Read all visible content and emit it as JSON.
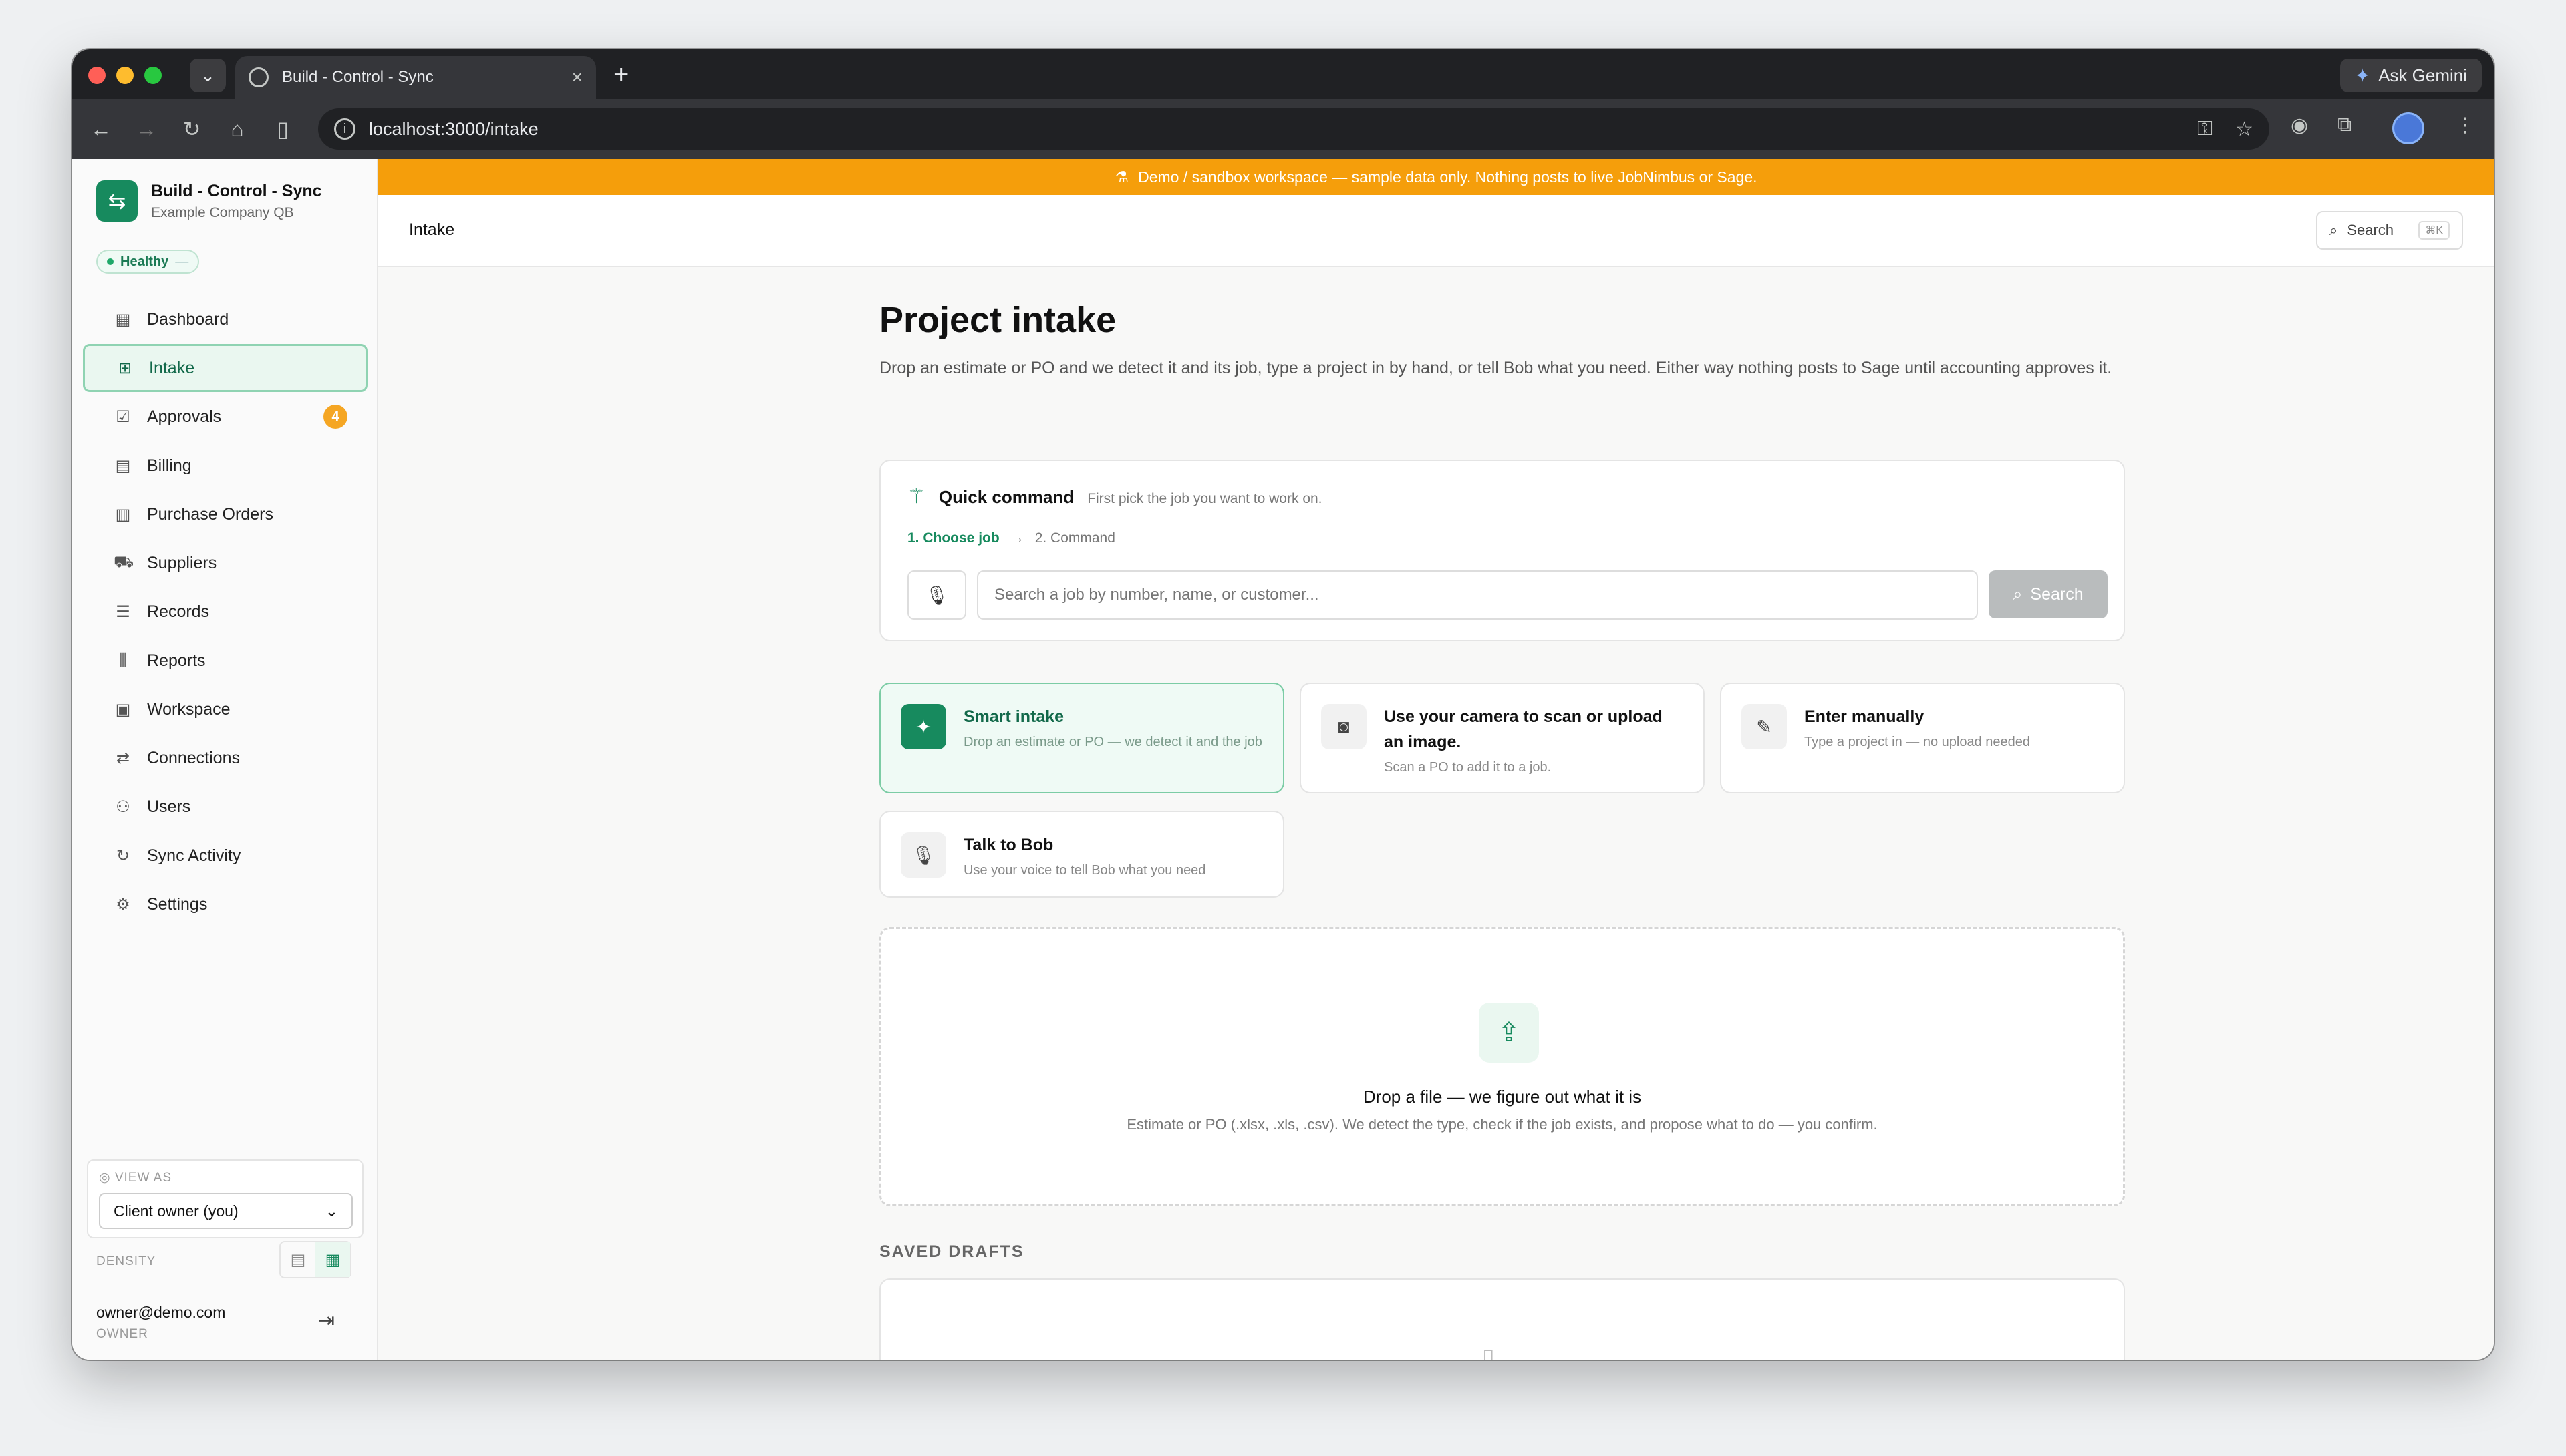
{
  "browser": {
    "tab_title": "Build - Control - Sync",
    "url": "localhost:3000/intake",
    "gemini_label": "Ask Gemini"
  },
  "sidebar": {
    "brand_name": "Build - Control - Sync",
    "brand_sub": "Example Company QB",
    "health_label": "Healthy",
    "health_extra": "—",
    "items": [
      {
        "label": "Dashboard",
        "icon": "dashboard-icon"
      },
      {
        "label": "Intake",
        "icon": "file-plus-icon"
      },
      {
        "label": "Approvals",
        "icon": "check-square-icon",
        "count": "4"
      },
      {
        "label": "Billing",
        "icon": "receipt-icon"
      },
      {
        "label": "Purchase Orders",
        "icon": "document-icon"
      },
      {
        "label": "Suppliers",
        "icon": "truck-icon"
      },
      {
        "label": "Records",
        "icon": "database-icon"
      },
      {
        "label": "Reports",
        "icon": "bar-chart-icon"
      },
      {
        "label": "Workspace",
        "icon": "building-icon"
      },
      {
        "label": "Connections",
        "icon": "connection-icon"
      },
      {
        "label": "Users",
        "icon": "users-icon"
      },
      {
        "label": "Sync Activity",
        "icon": "refresh-icon"
      },
      {
        "label": "Settings",
        "icon": "gear-icon"
      }
    ],
    "view_as_label": "VIEW AS",
    "view_as_value": "Client owner (you)",
    "density_label": "DENSITY",
    "account_email": "owner@demo.com",
    "account_role": "OWNER"
  },
  "banner": "Demo / sandbox workspace — sample data only. Nothing posts to live JobNimbus or Sage.",
  "topbar": {
    "breadcrumb": "Intake",
    "search_label": "Search",
    "search_shortcut": "⌘K"
  },
  "main": {
    "title": "Project intake",
    "description": "Drop an estimate or PO and we detect it and its job, type a project in by hand, or tell Bob what you need. Either way nothing posts to Sage until accounting approves it.",
    "quick_command": {
      "title": "Quick command",
      "hint": "First pick the job you want to work on.",
      "step1": "1. Choose job",
      "arrow": "→",
      "step2": "2. Command",
      "placeholder": "Search a job by number, name, or customer...",
      "button": "Search"
    },
    "options": [
      {
        "title": "Smart intake",
        "desc": "Drop an estimate or PO — we detect it and the job",
        "icon": "sparkle-icon"
      },
      {
        "title": "Use your camera to scan or upload an image.",
        "desc": "Scan a PO to add it to a job.",
        "icon": "camera-icon"
      },
      {
        "title": "Enter manually",
        "desc": "Type a project in — no upload needed",
        "icon": "pencil-icon"
      },
      {
        "title": "Talk to Bob",
        "desc": "Use your voice to tell Bob what you need",
        "icon": "microphone-icon"
      }
    ],
    "dropzone": {
      "title": "Drop a file — we figure out what it is",
      "subtitle": "Estimate or PO (.xlsx, .xls, .csv). We detect the type, check if the job exists, and propose what to do — you confirm."
    },
    "drafts_label": "SAVED DRAFTS"
  },
  "colors": {
    "accent": "#178a5e",
    "banner": "#f59e0b",
    "badge": "#f5a623"
  }
}
